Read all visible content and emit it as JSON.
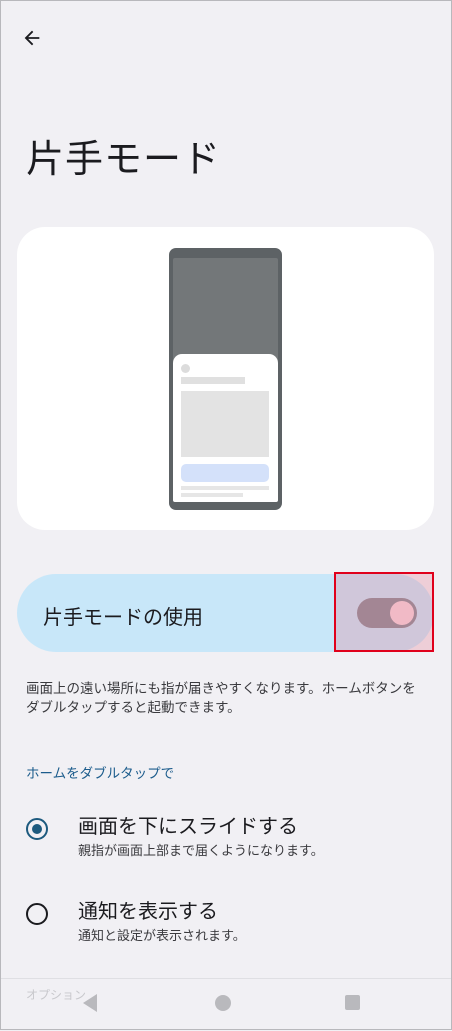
{
  "header": {
    "title": "片手モード",
    "back_icon": "arrow-left-icon"
  },
  "toggle": {
    "label": "片手モードの使用",
    "state": "on"
  },
  "description": "画面上の遠い場所にも指が届きやすくなります。ホームボタンをダブルタップすると起動できます。",
  "section": {
    "title": "ホームをダブルタップで"
  },
  "options": [
    {
      "title": "画面を下にスライドする",
      "subtitle": "親指が画面上部まで届くようになります。",
      "selected": true
    },
    {
      "title": "通知を表示する",
      "subtitle": "通知と設定が表示されます。",
      "selected": false
    }
  ],
  "partial_section": "オプション",
  "colors": {
    "background": "#f1f0f4",
    "toggle_row": "#c8e7f9",
    "accent": "#1d5a7e",
    "highlight": "#e0001b"
  }
}
